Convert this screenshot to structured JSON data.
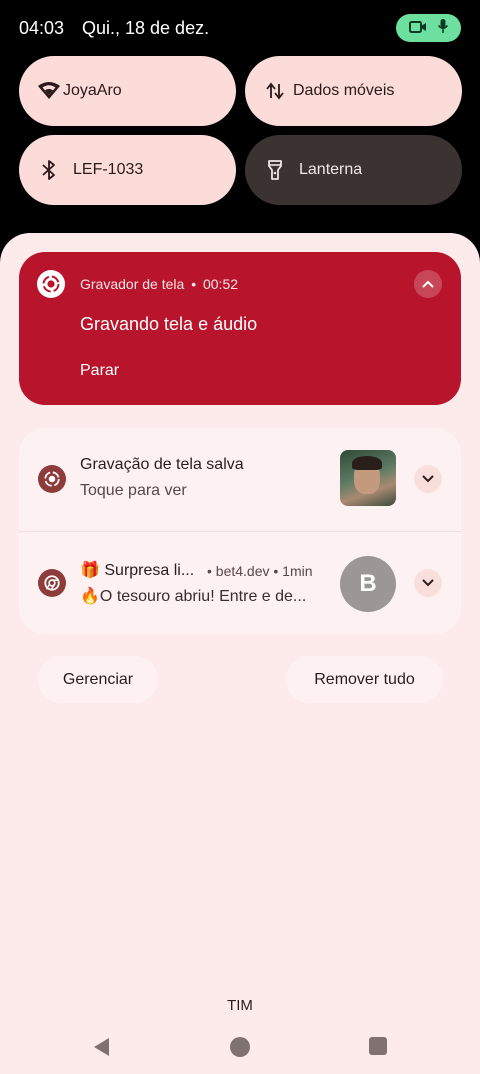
{
  "status_bar": {
    "time": "04:03",
    "date": "Qui., 18 de dez.",
    "recording_indicator_icons": [
      "video-camera-icon",
      "microphone-icon"
    ],
    "indicator_color": "#6de0a0"
  },
  "quick_tiles": [
    {
      "label": "JoyaAro",
      "icon": "wifi-icon",
      "state": "on"
    },
    {
      "label": "Dados móveis",
      "icon": "mobile-data-icon",
      "state": "on"
    },
    {
      "label": "LEF-1033",
      "icon": "bluetooth-icon",
      "state": "on"
    },
    {
      "label": "Lanterna",
      "icon": "flashlight-icon",
      "state": "off"
    }
  ],
  "recording_notification": {
    "app": "Gravador de tela",
    "separator": "•",
    "elapsed": "00:52",
    "title": "Gravando tela e áudio",
    "action": "Parar",
    "color": "#b8142b"
  },
  "notifications": [
    {
      "title": "Gravação de tela salva",
      "text": "Toque para ver",
      "icon": "screen-recorder-icon"
    },
    {
      "title": "🎁 Surpresa li...",
      "source": "• bet4.dev • 1min",
      "text": "🔥O tesouro abriu! Entre e de...",
      "icon": "chrome-icon",
      "avatar": "B"
    }
  ],
  "actions": {
    "manage": "Gerenciar",
    "clear_all": "Remover tudo"
  },
  "carrier": "TIM"
}
